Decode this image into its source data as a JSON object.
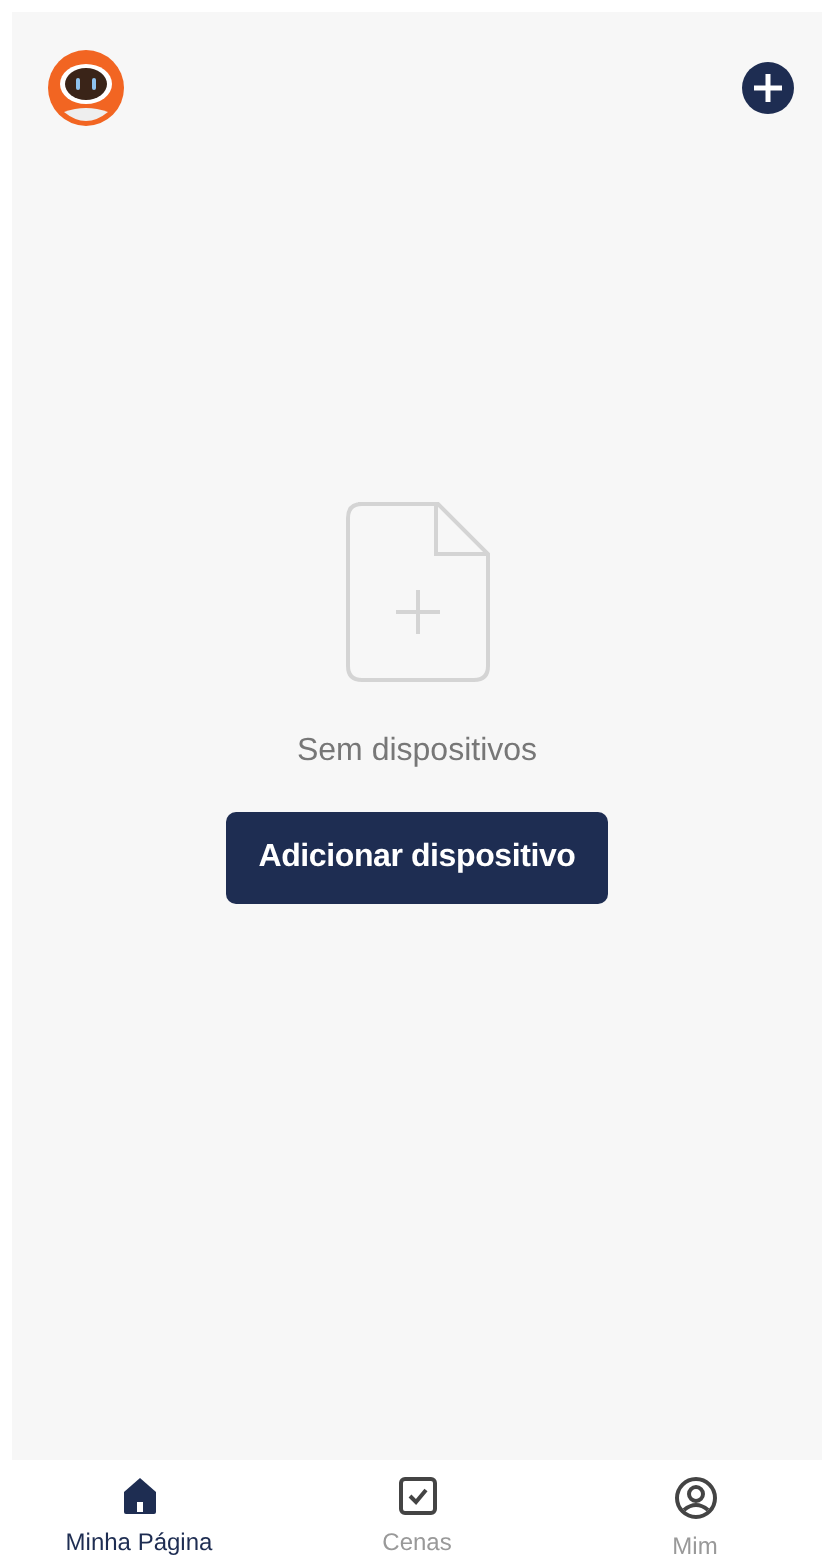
{
  "empty_state": {
    "message": "Sem dispositivos",
    "button": "Adicionar dispositivo"
  },
  "tabs": [
    {
      "label": "Minha Página",
      "kind": "home",
      "selected": true
    },
    {
      "label": "Cenas",
      "kind": "scenes",
      "selected": false
    },
    {
      "label": "Mim",
      "kind": "profile",
      "selected": false
    }
  ]
}
